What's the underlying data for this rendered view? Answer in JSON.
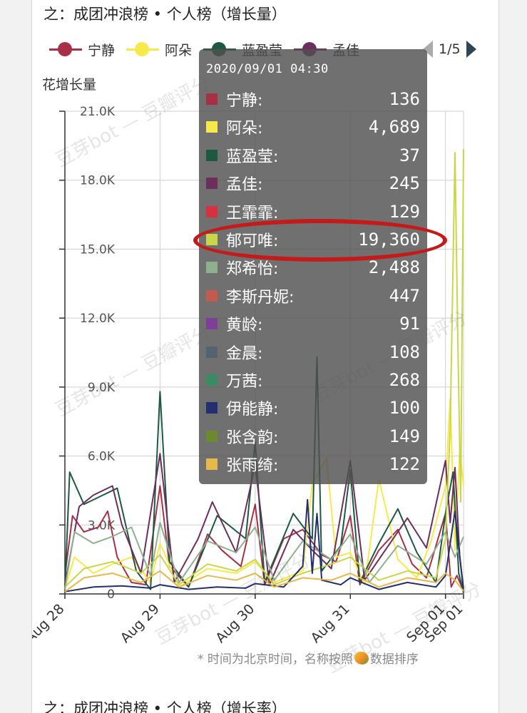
{
  "title": "之：成团冲浪榜 • 个人榜（增长量）",
  "next_title": "之：成团冲浪榜 • 个人榜（增长率）",
  "legend": {
    "items": [
      {
        "name": "宁静",
        "color": "#a83046"
      },
      {
        "name": "阿朵",
        "color": "#f7e94a"
      },
      {
        "name": "蓝盈莹",
        "color": "#1d5840"
      },
      {
        "name": "孟佳",
        "color": "#6c2e5c"
      }
    ],
    "page": "1/5"
  },
  "y_axis_label": "花增长量",
  "footnote": "* 时间为北京时间，名称按照",
  "footnote_end": "数据排序",
  "watermark": "豆芽bot — 豆瓣评分",
  "tooltip": {
    "time": "2020/09/01 04:30",
    "highlighted": "郁可唯",
    "rows": [
      {
        "name": "宁静:",
        "value": "136",
        "color": "#a83046"
      },
      {
        "name": "阿朵:",
        "value": "4,689",
        "color": "#f7e94a"
      },
      {
        "name": "蓝盈莹:",
        "value": "37",
        "color": "#1d5840"
      },
      {
        "name": "孟佳:",
        "value": "245",
        "color": "#6c2e5c"
      },
      {
        "name": "王霏霏:",
        "value": "129",
        "color": "#d9303e"
      },
      {
        "name": "郁可唯:",
        "value": "19,360",
        "color": "#c9d64a"
      },
      {
        "name": "郑希怡:",
        "value": "2,488",
        "color": "#8fb08f"
      },
      {
        "name": "李斯丹妮:",
        "value": "447",
        "color": "#c35a4f"
      },
      {
        "name": "黄龄:",
        "value": "91",
        "color": "#7e3f98"
      },
      {
        "name": "金晨:",
        "value": "108",
        "color": "#536373"
      },
      {
        "name": "万茜:",
        "value": "268",
        "color": "#3a8a63"
      },
      {
        "name": "伊能静:",
        "value": "100",
        "color": "#232f6e"
      },
      {
        "name": "张含韵:",
        "value": "149",
        "color": "#6b8a30"
      },
      {
        "name": "张雨绮:",
        "value": "122",
        "color": "#e8b84a"
      }
    ]
  },
  "chart_data": {
    "type": "line",
    "ylabel": "花增长量",
    "ylim": [
      0,
      21000
    ],
    "y_ticks": [
      "0",
      "3.0K",
      "6.0K",
      "9.0K",
      "12.0K",
      "15.0K",
      "18.0K",
      "21.0K"
    ],
    "y_tick_values": [
      0,
      3000,
      6000,
      9000,
      12000,
      15000,
      18000,
      21000
    ],
    "x_ticks": [
      "Aug 28",
      "Aug 29",
      "Aug 30",
      "Aug 31",
      "Sep 01",
      "Sep 01"
    ],
    "x_tick_positions": [
      0,
      1,
      2,
      3,
      4,
      4.19
    ],
    "xlim": [
      0,
      4.19
    ],
    "legend_position": "top",
    "series": [
      {
        "name": "宁静",
        "color": "#a83046",
        "x": [
          0,
          0.08,
          0.2,
          0.35,
          0.45,
          0.55,
          0.7,
          0.85,
          1.0,
          1.1,
          1.3,
          1.5,
          1.65,
          1.85,
          2.0,
          2.1,
          2.3,
          2.5,
          2.7,
          2.85,
          3.0,
          3.1,
          3.3,
          3.5,
          3.65,
          3.8,
          4.0,
          4.06,
          4.12,
          4.19
        ],
        "y": [
          800,
          3400,
          2700,
          2900,
          3600,
          1600,
          500,
          400,
          4700,
          1200,
          300,
          2600,
          1900,
          1200,
          3900,
          400,
          2400,
          2800,
          1700,
          1400,
          3400,
          400,
          1900,
          2800,
          1300,
          700,
          3500,
          300,
          800,
          136
        ]
      },
      {
        "name": "阿朵",
        "color": "#f7e94a",
        "x": [
          0,
          0.1,
          0.3,
          0.5,
          0.7,
          0.9,
          1.0,
          1.2,
          1.5,
          1.8,
          2.0,
          2.2,
          2.5,
          2.6,
          2.75,
          2.85,
          3.0,
          3.15,
          3.3,
          3.5,
          3.7,
          3.85,
          4.0,
          4.05,
          4.1,
          4.15,
          4.19
        ],
        "y": [
          200,
          1600,
          900,
          1300,
          1600,
          500,
          2200,
          300,
          1100,
          900,
          1400,
          500,
          1000,
          4800,
          5900,
          1600,
          1800,
          400,
          5000,
          1500,
          700,
          2300,
          4700,
          8500,
          1900,
          6300,
          4689
        ]
      },
      {
        "name": "蓝盈莹",
        "color": "#1d5840",
        "x": [
          0,
          0.05,
          0.2,
          0.4,
          0.55,
          0.75,
          0.9,
          1.0,
          1.1,
          1.3,
          1.6,
          1.9,
          2.0,
          2.1,
          2.4,
          2.6,
          2.65,
          2.7,
          2.9,
          3.0,
          3.1,
          3.3,
          3.5,
          3.7,
          3.9,
          4.0,
          4.08,
          4.14,
          4.19
        ],
        "y": [
          200,
          5300,
          3900,
          4300,
          4600,
          1000,
          200,
          8800,
          1400,
          300,
          3400,
          2400,
          6600,
          500,
          3500,
          2400,
          10300,
          1000,
          2100,
          5400,
          500,
          2200,
          3700,
          1800,
          500,
          3500,
          5300,
          900,
          37
        ]
      },
      {
        "name": "孟佳",
        "color": "#6c2e5c",
        "x": [
          0,
          0.15,
          0.3,
          0.5,
          0.6,
          0.8,
          1.0,
          1.15,
          1.4,
          1.55,
          1.8,
          2.0,
          2.15,
          2.4,
          2.6,
          2.8,
          3.0,
          3.15,
          3.4,
          3.6,
          3.8,
          4.0,
          4.05,
          4.1,
          4.15,
          4.19
        ],
        "y": [
          400,
          3800,
          4300,
          4700,
          3000,
          900,
          6100,
          500,
          2400,
          4000,
          1800,
          5600,
          400,
          2800,
          1900,
          1100,
          5800,
          600,
          2100,
          3300,
          2000,
          5800,
          3100,
          5500,
          1600,
          245
        ]
      },
      {
        "name": "郁可唯",
        "color": "#c9d64a",
        "x": [
          0,
          0.2,
          0.5,
          0.8,
          1.0,
          1.2,
          1.5,
          1.8,
          2.0,
          2.2,
          2.5,
          2.8,
          3.0,
          3.3,
          3.6,
          3.9,
          4.0,
          4.05,
          4.1,
          4.13,
          4.16,
          4.19
        ],
        "y": [
          300,
          1100,
          1400,
          900,
          1700,
          400,
          1300,
          1000,
          1500,
          400,
          900,
          1300,
          1600,
          600,
          1000,
          700,
          2400,
          7200,
          19200,
          11000,
          4000,
          19360
        ]
      },
      {
        "name": "郑希怡",
        "color": "#8fb08f",
        "x": [
          0,
          0.1,
          0.3,
          0.5,
          0.7,
          0.9,
          1.0,
          1.2,
          1.5,
          1.8,
          2.0,
          2.2,
          2.5,
          2.8,
          3.0,
          3.2,
          3.5,
          3.8,
          4.0,
          4.1,
          4.19
        ],
        "y": [
          200,
          2700,
          2200,
          2500,
          2900,
          800,
          3100,
          500,
          2300,
          1800,
          2900,
          600,
          2300,
          1500,
          2600,
          500,
          2100,
          1300,
          2700,
          1600,
          2488
        ]
      },
      {
        "name": "伊能静",
        "color": "#232f6e",
        "x": [
          0,
          0.3,
          0.6,
          0.9,
          1.0,
          1.3,
          1.6,
          1.9,
          2.0,
          2.3,
          2.5,
          2.55,
          2.6,
          2.65,
          2.7,
          2.9,
          3.0,
          3.3,
          3.6,
          3.9,
          4.0,
          4.1,
          4.19
        ],
        "y": [
          100,
          300,
          350,
          250,
          400,
          200,
          300,
          250,
          450,
          300,
          1200,
          4100,
          900,
          3500,
          600,
          400,
          700,
          200,
          500,
          300,
          800,
          3600,
          100
        ]
      },
      {
        "name": "张雨绮",
        "color": "#e8b84a",
        "x": [
          0,
          0.2,
          0.5,
          0.8,
          1.0,
          1.2,
          1.5,
          1.8,
          2.0,
          2.2,
          2.5,
          2.8,
          3.0,
          3.3,
          3.6,
          3.9,
          4.0,
          4.1,
          4.19
        ],
        "y": [
          100,
          700,
          900,
          500,
          1000,
          300,
          800,
          600,
          900,
          300,
          700,
          600,
          900,
          300,
          700,
          500,
          900,
          600,
          122
        ]
      }
    ]
  }
}
